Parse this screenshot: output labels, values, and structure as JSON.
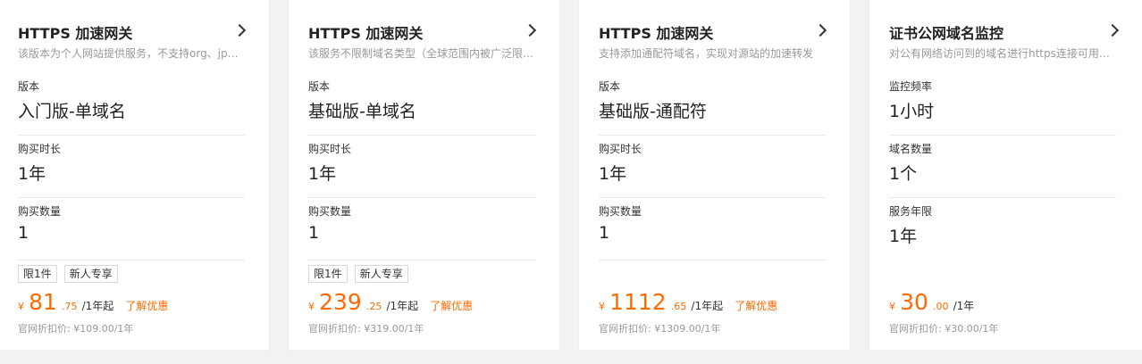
{
  "cards": [
    {
      "title": "HTTPS 加速网关",
      "description": "该版本为个人网站提供服务，不支持org、jp等…",
      "specs": [
        {
          "label": "版本",
          "value": "入门版-单域名"
        },
        {
          "label": "购买时长",
          "value": "1年"
        },
        {
          "label": "购买数量",
          "value": "1"
        }
      ],
      "tags": [
        "限1件",
        "新人专享"
      ],
      "price": {
        "currency": "¥",
        "integer": "81",
        "decimal": ".75",
        "unit": "/1年起",
        "promo": "了解优惠"
      },
      "original_price": "官网折扣价: ¥109.00/1年"
    },
    {
      "title": "HTTPS 加速网关",
      "description": "该服务不限制域名类型（全球范围内被广泛限…",
      "specs": [
        {
          "label": "版本",
          "value": "基础版-单域名"
        },
        {
          "label": "购买时长",
          "value": "1年"
        },
        {
          "label": "购买数量",
          "value": "1"
        }
      ],
      "tags": [
        "限1件",
        "新人专享"
      ],
      "price": {
        "currency": "¥",
        "integer": "239",
        "decimal": ".25",
        "unit": "/1年起",
        "promo": "了解优惠"
      },
      "original_price": "官网折扣价: ¥319.00/1年"
    },
    {
      "title": "HTTPS 加速网关",
      "description": "支持添加通配符域名，实现对源站的加速转发",
      "specs": [
        {
          "label": "版本",
          "value": "基础版-通配符"
        },
        {
          "label": "购买时长",
          "value": "1年"
        },
        {
          "label": "购买数量",
          "value": "1"
        }
      ],
      "tags": [],
      "price": {
        "currency": "¥",
        "integer": "1112",
        "decimal": ".65",
        "unit": "/1年起",
        "promo": "了解优惠"
      },
      "original_price": "官网折扣价: ¥1309.00/1年"
    },
    {
      "title": "证书公网域名监控",
      "description": "对公有网络访问到的域名进行https连接可用性…",
      "specs": [
        {
          "label": "监控频率",
          "value": "1小时"
        },
        {
          "label": "域名数量",
          "value": "1个"
        },
        {
          "label": "服务年限",
          "value": "1年"
        }
      ],
      "tags": [],
      "price": {
        "currency": "¥",
        "integer": "30",
        "decimal": ".00",
        "unit": "/1年",
        "promo": ""
      },
      "original_price": "官网折扣价: ¥30.00/1年"
    }
  ],
  "colors": {
    "accent": "#ff6a00",
    "muted": "#999999",
    "divider": "#e8e8e8"
  },
  "icons": {
    "card_link": "chevron-right-icon"
  }
}
